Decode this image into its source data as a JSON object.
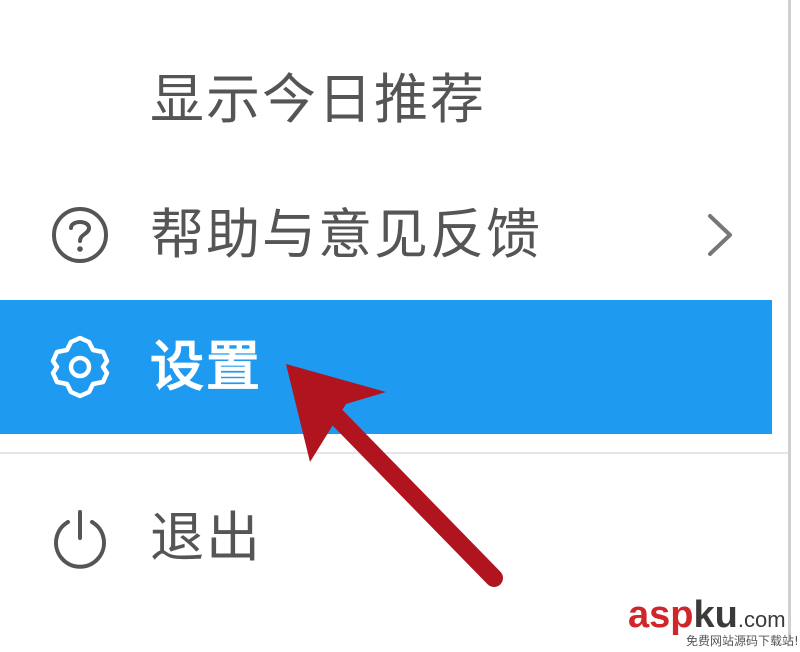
{
  "menu": {
    "items": [
      {
        "label": "显示今日推荐",
        "icon": "none"
      },
      {
        "label": "帮助与意见反馈",
        "icon": "help-circle-icon",
        "has_submenu": true
      },
      {
        "label": "设置",
        "icon": "gear-icon",
        "highlighted": true
      },
      {
        "label": "退出",
        "icon": "power-icon"
      }
    ]
  },
  "colors": {
    "highlight": "#1e9af0",
    "text": "#555555",
    "highlight_text": "#ffffff",
    "annotation_arrow": "#b0141e"
  },
  "watermark": {
    "brand_a": "asp",
    "brand_b": "ku",
    "brand_c": ".com",
    "tagline": "免费网站源码下载站!"
  }
}
